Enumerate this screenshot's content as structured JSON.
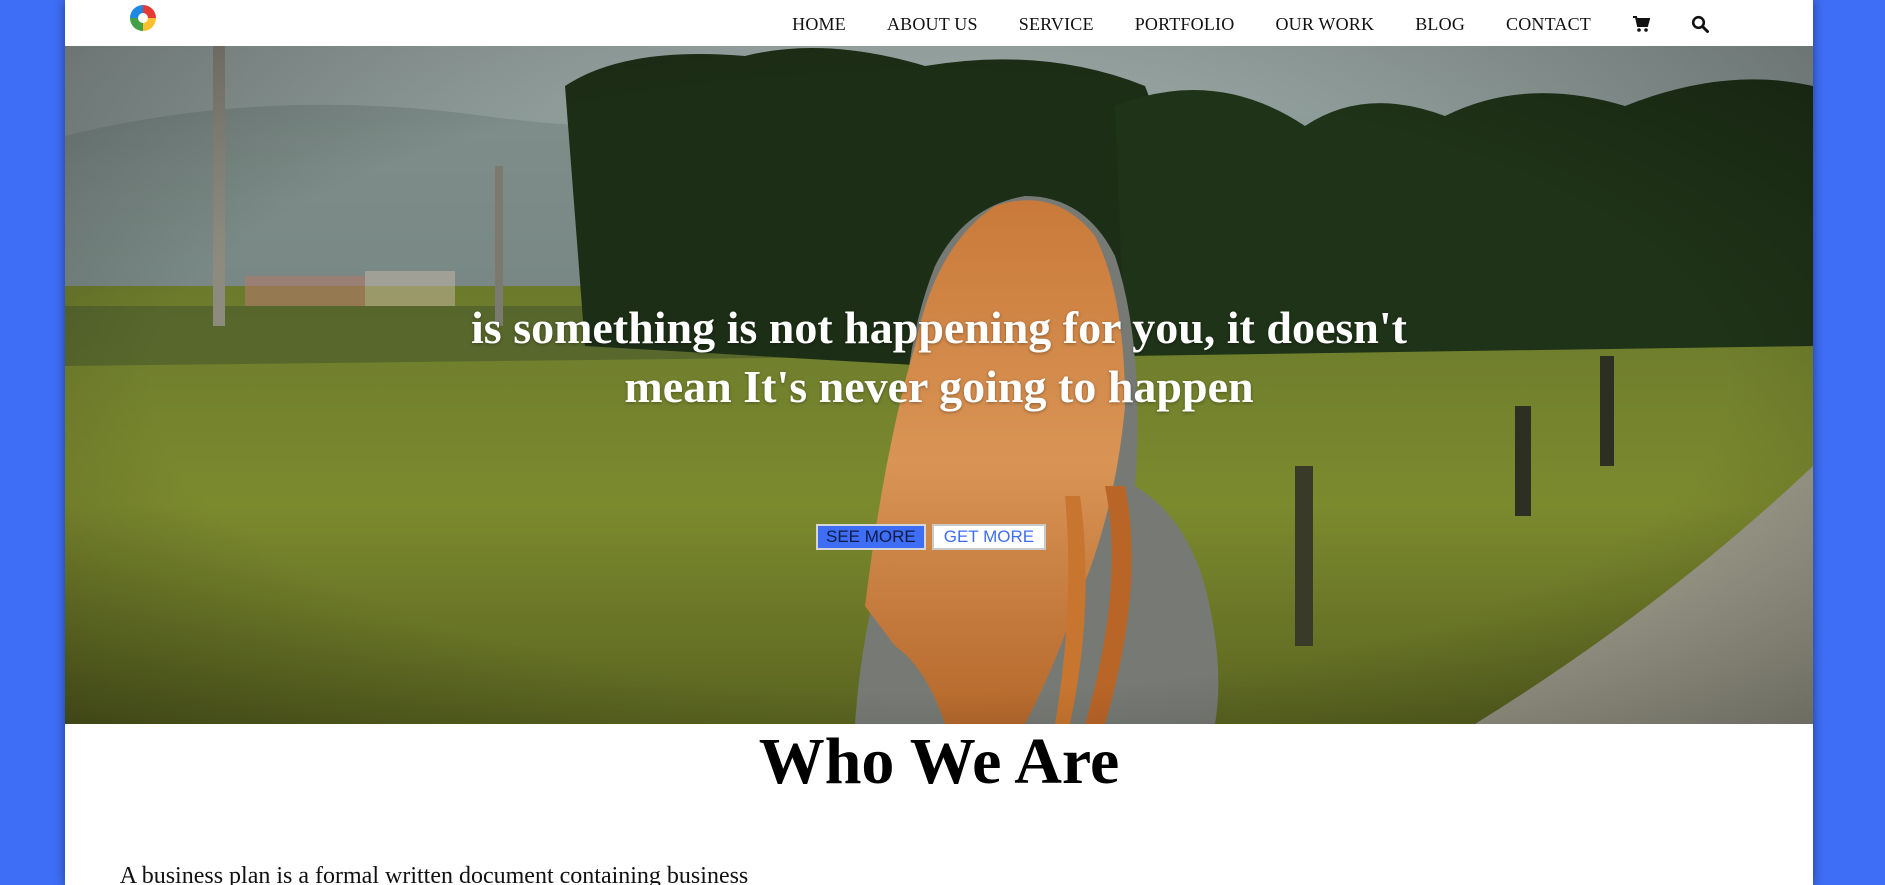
{
  "nav": {
    "items": [
      {
        "label": "HOME"
      },
      {
        "label": "ABOUT US"
      },
      {
        "label": "SERVICE"
      },
      {
        "label": "PORTFOLIO"
      },
      {
        "label": "OUR WORK"
      },
      {
        "label": "BLOG"
      },
      {
        "label": "CONTACT"
      }
    ],
    "icons": [
      "cart-icon",
      "search-icon"
    ]
  },
  "hero": {
    "headline_line1": "is something is not happening for you, it doesn't",
    "headline_line2": "mean It's never going to happen",
    "see_more": "SEE MORE",
    "get_more": "GET MORE"
  },
  "about": {
    "title": "Who We Are",
    "body": "A business plan is a formal written document containing business goals, the methods on how these goals can be attained, and the time"
  },
  "colors": {
    "accent": "#3e6ef5",
    "page_bg": "#ffffff",
    "text": "#000000"
  }
}
